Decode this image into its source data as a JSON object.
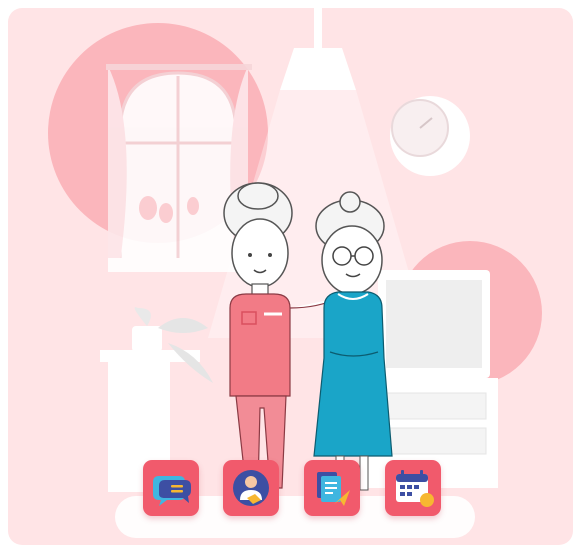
{
  "scene": {
    "illustration": "caregiver-and-elderly-woman",
    "colors": {
      "background": "#ffe4e6",
      "accent_circle": "#fbb6bc",
      "caregiver_uniform": "#f27b86",
      "dress": "#1aa5c8",
      "dock_button": "#f15a6c"
    }
  },
  "dock": {
    "buttons": [
      {
        "icon": "chat-bubble-icon"
      },
      {
        "icon": "caregiver-profile-icon"
      },
      {
        "icon": "document-send-icon"
      },
      {
        "icon": "calendar-icon"
      }
    ]
  }
}
